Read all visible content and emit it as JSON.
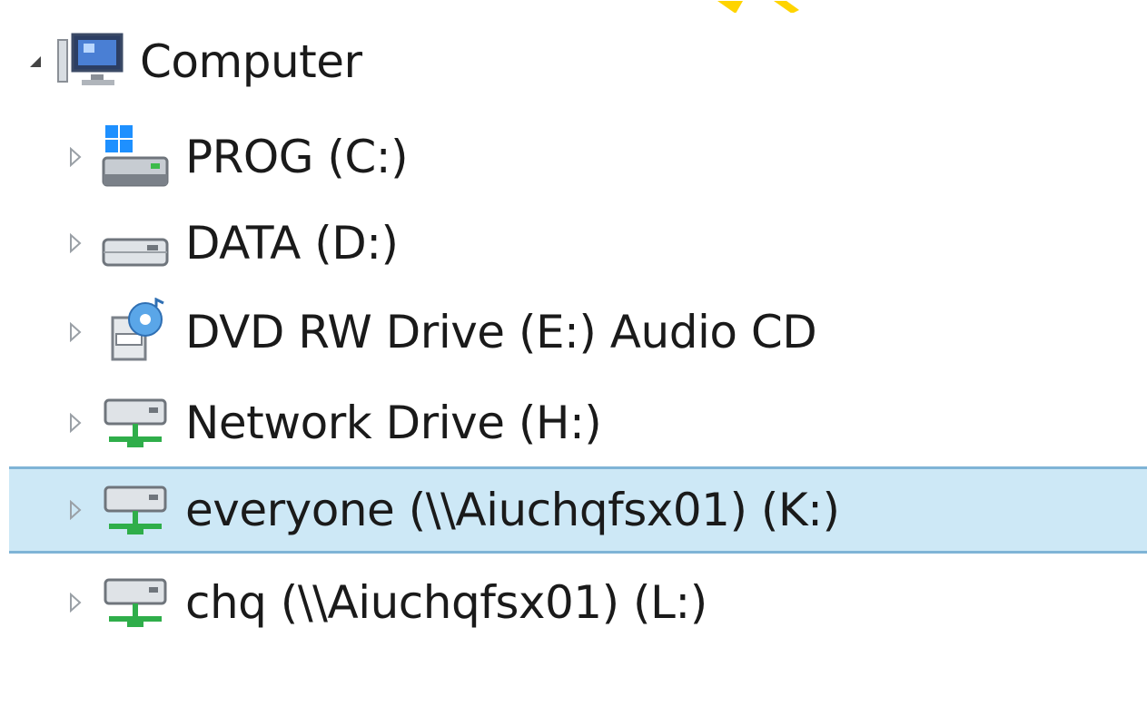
{
  "tree": {
    "root": {
      "label": "Computer",
      "icon": "computer-icon",
      "expanded": true
    },
    "items": [
      {
        "label": "PROG (C:)",
        "icon": "system-drive-icon"
      },
      {
        "label": "DATA (D:)",
        "icon": "hard-drive-icon"
      },
      {
        "label": "DVD RW Drive (E:) Audio CD",
        "icon": "audio-cd-icon"
      },
      {
        "label": "Network Drive (H:)",
        "icon": "network-drive-icon"
      },
      {
        "label": "everyone (\\\\Aiuchqfsx01) (K:)",
        "icon": "network-drive-icon",
        "selected": true
      },
      {
        "label": "chq (\\\\Aiuchqfsx01) (L:)",
        "icon": "network-drive-icon"
      }
    ]
  },
  "colors": {
    "selection_bg": "#cde8f6",
    "selection_border": "#7fb4d6",
    "network_green": "#2fae4a",
    "drive_gray": "#8a8f96",
    "windows_blue": "#1e90ff"
  }
}
